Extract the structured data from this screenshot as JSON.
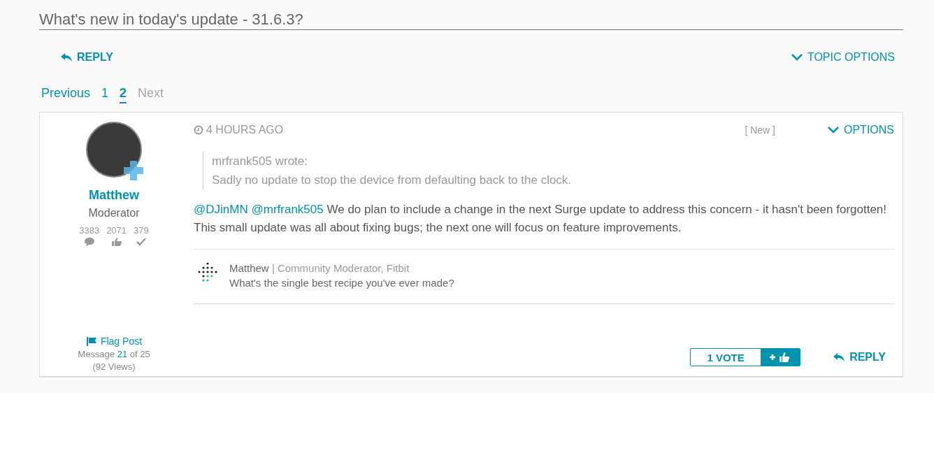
{
  "title": "What's new in today's update - 31.6.3?",
  "toolbar": {
    "reply": "REPLY",
    "topic_options": "TOPIC OPTIONS"
  },
  "pagination": {
    "previous": "Previous",
    "next": "Next",
    "next_disabled": true,
    "pages": [
      {
        "label": "1",
        "selected": false
      },
      {
        "label": "2",
        "selected": true
      }
    ]
  },
  "post": {
    "author": {
      "name": "Matthew",
      "rank": "Moderator",
      "stats": [
        {
          "kind": "posts",
          "value": "3383"
        },
        {
          "kind": "kudos",
          "value": "2071"
        },
        {
          "kind": "solutions",
          "value": "379"
        }
      ]
    },
    "time": "4 HOURS AGO",
    "new_tag": "[ New ]",
    "options": "OPTIONS",
    "quote": {
      "author": "mrfrank505 wrote:",
      "text": "Sadly no update to stop the device from defaulting back to the clock."
    },
    "mentions": [
      "@DJinMN",
      "@mrfrank505"
    ],
    "body": "We do plan to include a change in the next Surge update to address this concern - it hasn't been forgotten! This small update was all about fixing bugs; the next one will focus on feature improvements.",
    "signature": {
      "name": "Matthew",
      "title": "| Community Moderator, Fitbit",
      "text": "What's the single best recipe you've ever made?"
    },
    "flag": "Flag Post",
    "message": {
      "prefix": "Message",
      "number": "21",
      "suffix": "of 25"
    },
    "views": "(92 Views)",
    "votes": "1 VOTE",
    "reply": "REPLY"
  }
}
